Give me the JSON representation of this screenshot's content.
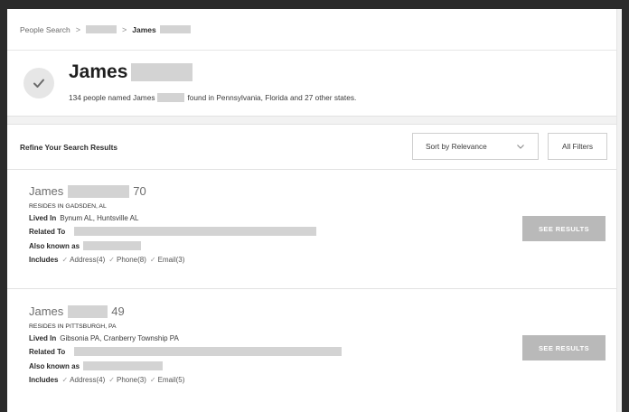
{
  "breadcrumb": {
    "root": "People Search",
    "sep": ">",
    "current": "James"
  },
  "hero": {
    "first_name": "James",
    "summary_prefix": "134 people named James",
    "summary_suffix": "found in Pennsylvania, Florida and 27 other states."
  },
  "refine": {
    "label": "Refine Your Search Results",
    "sort_value": "Sort by Relevance",
    "filters_label": "All Filters"
  },
  "results": [
    {
      "first_name": "James",
      "age": "70",
      "resides": "RESIDES IN GADSDEN, AL",
      "lived_in_label": "Lived In",
      "lived_in_value": "Bynum AL, Huntsville AL",
      "related_label": "Related To",
      "aka_label": "Also known as",
      "includes_label": "Includes",
      "includes": [
        "Address(4)",
        "Phone(8)",
        "Email(3)"
      ],
      "button": "SEE RESULTS"
    },
    {
      "first_name": "James",
      "age": "49",
      "resides": "RESIDES IN PITTSBURGH, PA",
      "lived_in_label": "Lived In",
      "lived_in_value": "Gibsonia PA, Cranberry Township PA",
      "related_label": "Related To",
      "aka_label": "Also known as",
      "includes_label": "Includes",
      "includes": [
        "Address(4)",
        "Phone(3)",
        "Email(5)"
      ],
      "button": "SEE RESULTS"
    }
  ],
  "icons": {
    "hero": "checkmark-icon",
    "sort": "chevron-down-icon",
    "include_item": "checkmark-icon"
  },
  "colors": {
    "button_bg": "#b9b9b9",
    "redaction": "#d3d3d3"
  }
}
